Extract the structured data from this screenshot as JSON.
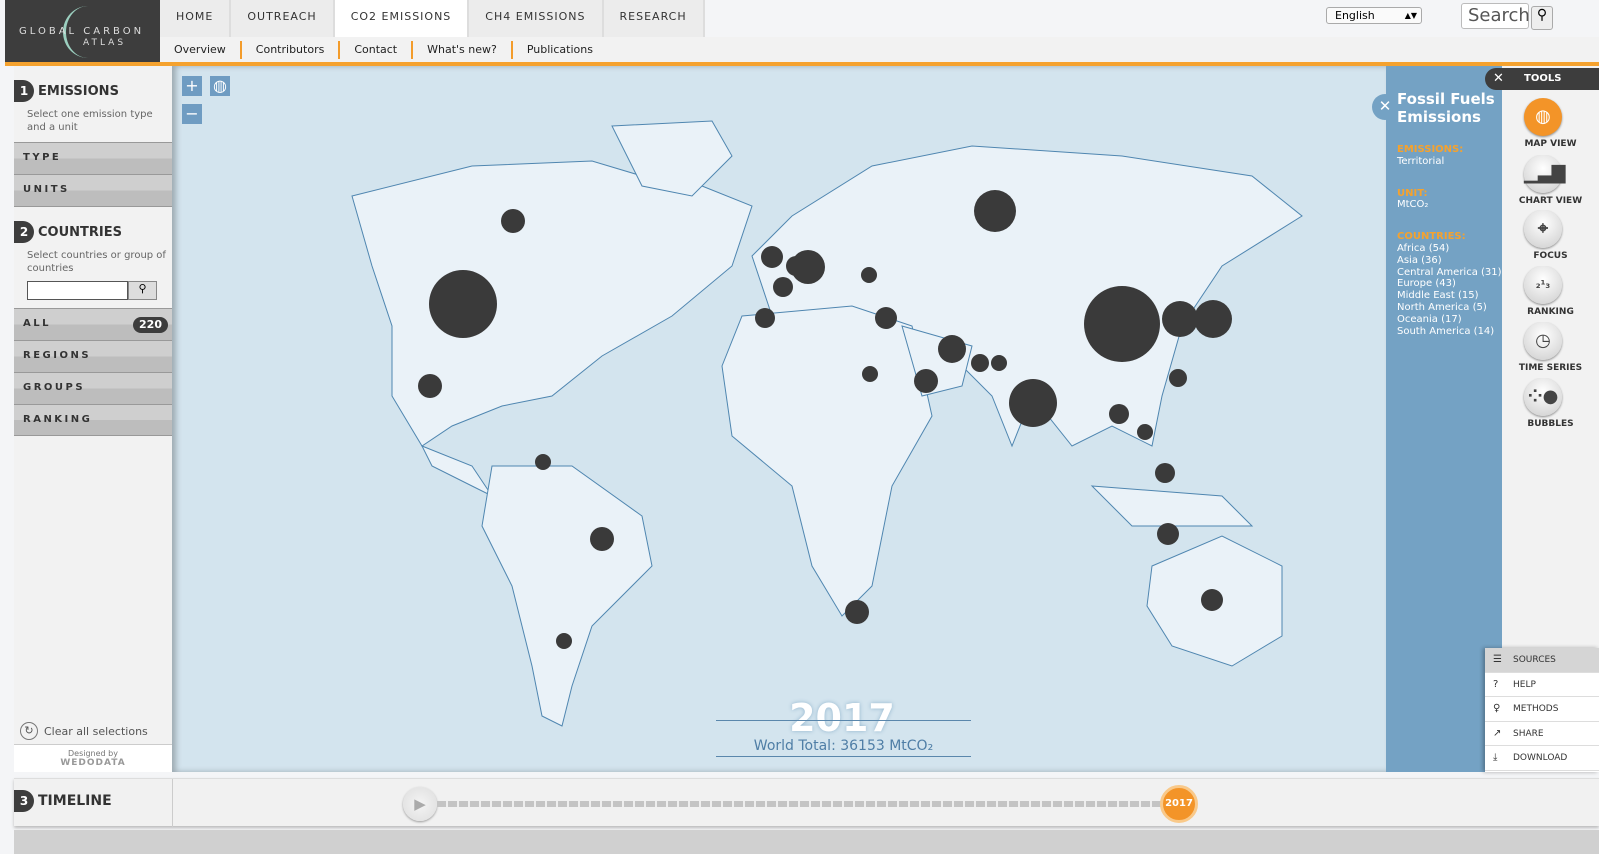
{
  "logo": {
    "line1": "GLOBAL CARBON",
    "line2": "ATLAS"
  },
  "topnav": [
    {
      "label": "HOME"
    },
    {
      "label": "OUTREACH"
    },
    {
      "label": "CO2 EMISSIONS",
      "active": true
    },
    {
      "label": "CH4 EMISSIONS"
    },
    {
      "label": "RESEARCH"
    }
  ],
  "subnav": [
    "Overview",
    "Contributors",
    "Contact",
    "What's new?",
    "Publications"
  ],
  "language": "English",
  "search": {
    "placeholder": "Search"
  },
  "left": {
    "emissions": {
      "num": "1",
      "title": "EMISSIONS",
      "desc": "Select one emission type and a unit",
      "type": "TYPE",
      "units": "UNITS"
    },
    "countries": {
      "num": "2",
      "title": "COUNTRIES",
      "desc": "Select countries or group of countries",
      "input_value": "",
      "all": "ALL",
      "all_count": "220",
      "regions": "REGIONS",
      "groups": "GROUPS",
      "ranking": "RANKING"
    },
    "clear": "Clear all selections",
    "designed_by": "Designed by",
    "designer": "WEDODATA"
  },
  "map": {
    "zoom_in": "+",
    "zoom_out": "−",
    "year": "2017",
    "world_total": "World Total: 36153 MtCO₂"
  },
  "info": {
    "title": "Fossil Fuels Emissions",
    "emissions_label": "EMISSIONS:",
    "emissions_value": "Territorial",
    "unit_label": "UNIT:",
    "unit_value": "MtCO₂",
    "countries_label": "COUNTRIES:",
    "countries": [
      "Africa (54)",
      "Asia (36)",
      "Central America (31)",
      "Europe (43)",
      "Middle East (15)",
      "North America (5)",
      "Oceania (17)",
      "South America (14)"
    ]
  },
  "tools": {
    "title": "TOOLS",
    "items": [
      {
        "label": "MAP VIEW",
        "icon": "globe-icon",
        "active": true
      },
      {
        "label": "CHART VIEW",
        "icon": "bar-chart-icon"
      },
      {
        "label": "FOCUS",
        "icon": "crosshair-icon"
      },
      {
        "label": "RANKING",
        "icon": "podium-icon"
      },
      {
        "label": "TIME SERIES",
        "icon": "clock-icon"
      },
      {
        "label": "BUBBLES",
        "icon": "bubbles-icon"
      }
    ]
  },
  "menu": [
    {
      "label": "SOURCES",
      "icon": "document-icon"
    },
    {
      "label": "HELP",
      "icon": "help-icon"
    },
    {
      "label": "METHODS",
      "icon": "lightbulb-icon"
    },
    {
      "label": "SHARE",
      "icon": "share-icon"
    },
    {
      "label": "DOWNLOAD",
      "icon": "download-icon"
    }
  ],
  "timeline": {
    "num": "3",
    "title": "TIMELINE",
    "year": "2017"
  },
  "colors": {
    "accent": "#f5a22e",
    "map_bg": "#d3e4ee",
    "land": "#eaf2f8",
    "panel": "#74a2c4",
    "bubble": "#3a3a3a"
  }
}
